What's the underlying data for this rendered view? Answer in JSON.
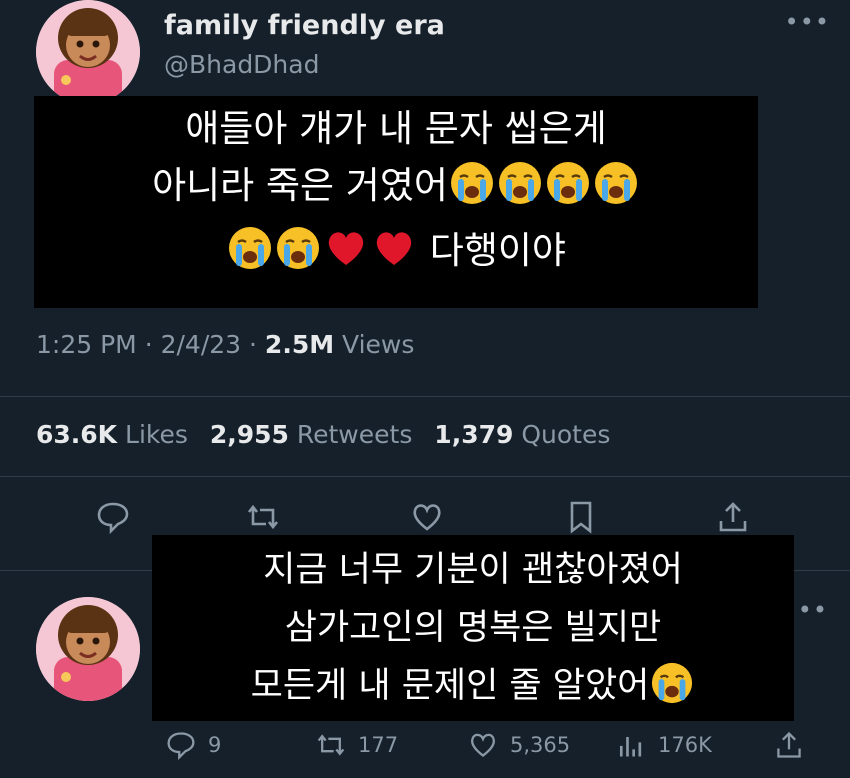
{
  "tweet": {
    "display_name": "family friendly era",
    "handle": "@BhadDhad",
    "more_icon": "more-dots-icon",
    "meta": {
      "time": "1:25 PM",
      "sep1": "·",
      "date": "2/4/23",
      "sep2": "·",
      "views_count": "2.5M",
      "views_label": "Views"
    },
    "stats": {
      "likes_count": "63.6K",
      "likes_label": "Likes",
      "retweets_count": "2,955",
      "retweets_label": "Retweets",
      "quotes_count": "1,379",
      "quotes_label": "Quotes"
    },
    "actions": [
      "reply-icon",
      "retweet-icon",
      "like-icon",
      "bookmark-icon",
      "share-icon"
    ]
  },
  "caption_top": {
    "line1": "애들아 걔가 내 문자 씹은게",
    "line2": "아니라 죽은 거였어",
    "line3": "다행이야"
  },
  "caption_bottom": {
    "line1": "지금 너무 기분이 괜찮아졌어",
    "line2": "삼가고인의 명복은 빌지만",
    "line3": "모든게 내 문제인 줄 알았어"
  },
  "reply_tweet": {
    "more_icon": "more-dots-icon",
    "replies": "9",
    "retweets": "177",
    "likes": "5,365",
    "views": "176K"
  },
  "colors": {
    "background": "#15202b",
    "text_primary": "#e7e9ea",
    "text_secondary": "#8b98a5",
    "caption_bg": "#000000",
    "emoji_face": "#f6c026",
    "heart": "#e0162b"
  }
}
